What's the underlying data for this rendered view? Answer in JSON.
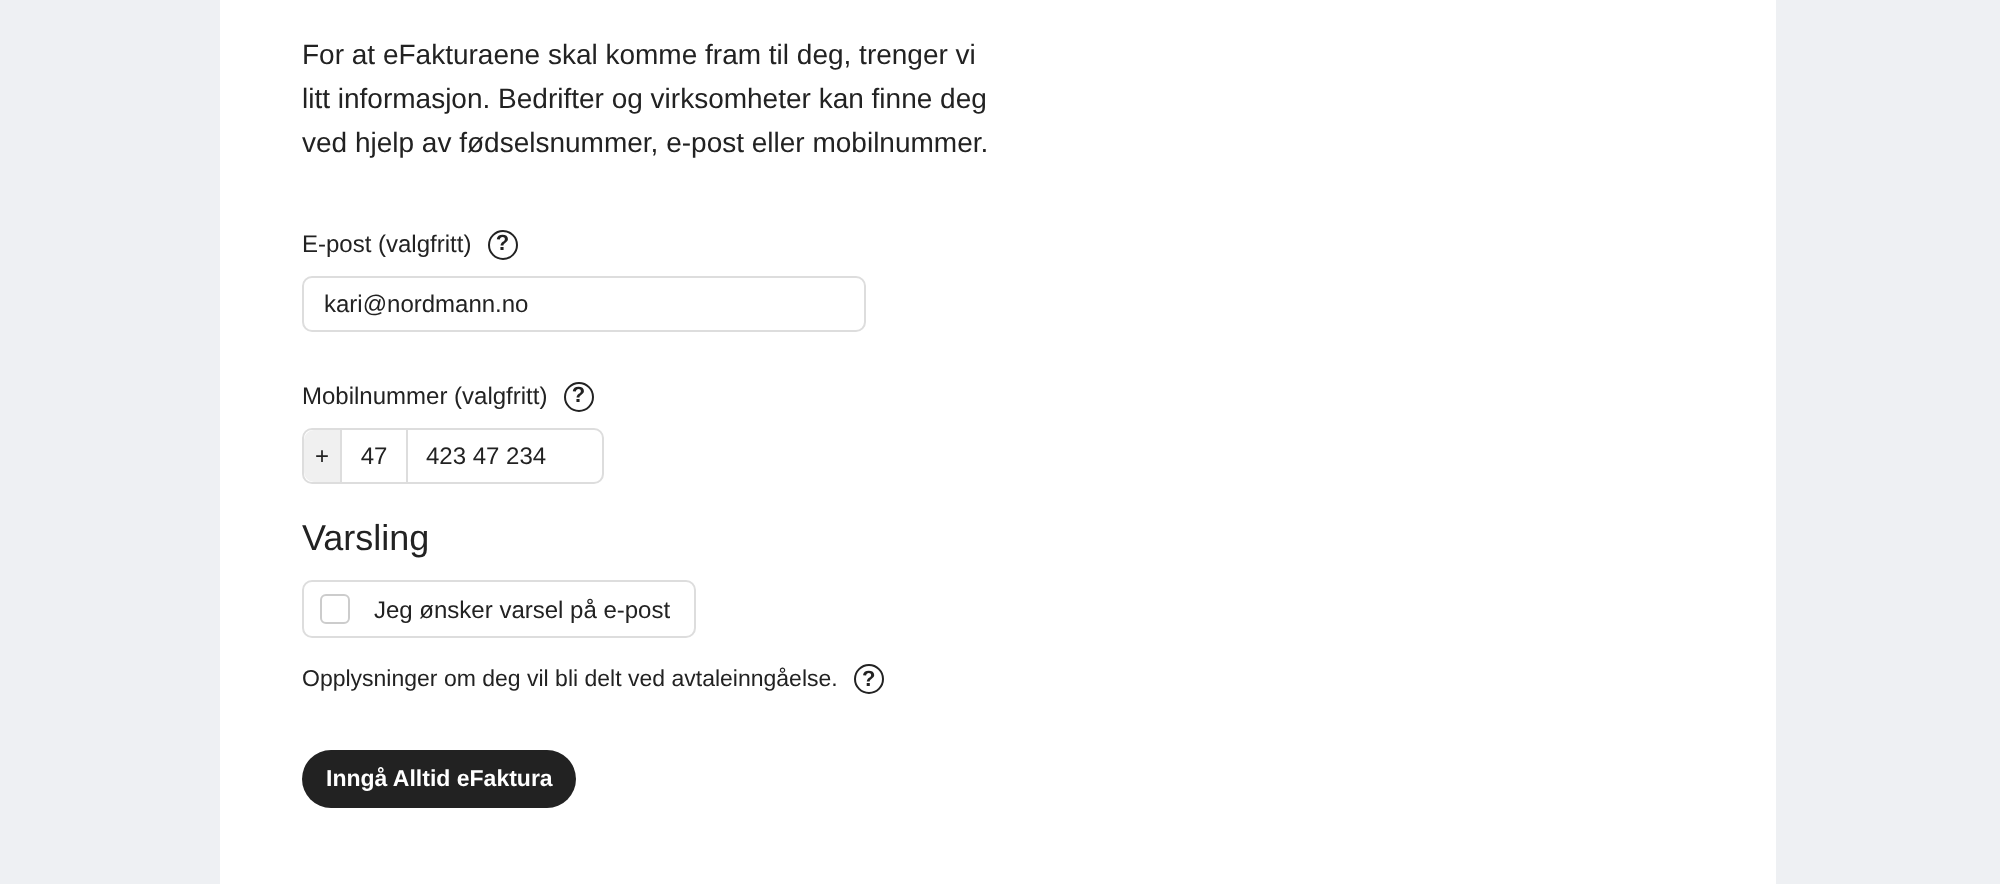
{
  "intro": "For at eFakturaene skal komme fram til deg, trenger vi litt informasjon. Bedrifter og virksomheter kan finne deg ved hjelp av fødselsnummer, e-post eller mobilnummer.",
  "email": {
    "label": "E-post (valgfritt)",
    "help": "?",
    "value": "kari@nordmann.no"
  },
  "mobile": {
    "label": "Mobilnummer (valgfritt)",
    "help": "?",
    "prefix": "+",
    "country_code": "47",
    "value": "423 47 234"
  },
  "notification": {
    "heading": "Varsling",
    "checkbox": {
      "label": "Jeg ønsker varsel på e-post",
      "checked": false
    }
  },
  "consent": {
    "text": "Opplysninger om deg vil bli delt ved avtaleinngåelse.",
    "help": "?"
  },
  "submit": "Inngå Alltid eFaktura"
}
